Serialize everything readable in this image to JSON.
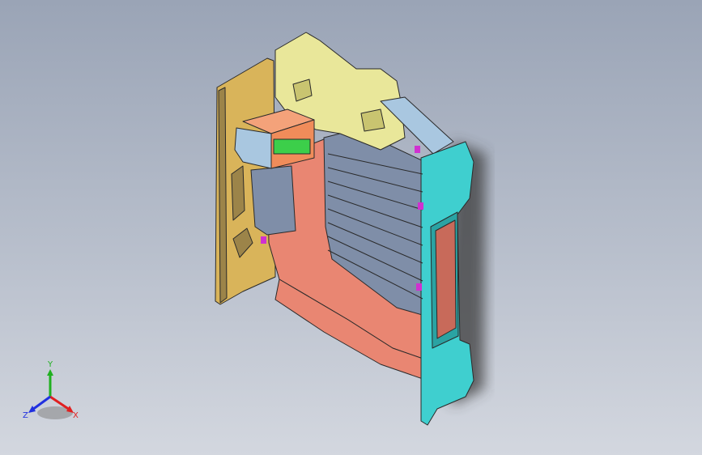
{
  "viewport": {
    "background_top": "#9aa4b6",
    "background_bottom": "#d3d7df"
  },
  "model": {
    "colors": {
      "yellow_panel": "#e9e79a",
      "tan_panel": "#d9b45a",
      "salmon_panel": "#e98672",
      "teal_panel": "#3fcfcf",
      "light_blue_panel": "#a9c7e0",
      "grey_blue_panel": "#7f8ea8",
      "orange_box": "#f08c5a",
      "green_label": "#3ccf4a",
      "magenta_marker": "#d030d0",
      "outline": "#2a2a2a",
      "shadow": "#3a3a3a"
    }
  },
  "triad": {
    "x_label": "X",
    "y_label": "Y",
    "z_label": "Z",
    "x_color": "#e02020",
    "y_color": "#20b020",
    "z_color": "#2030e0"
  }
}
